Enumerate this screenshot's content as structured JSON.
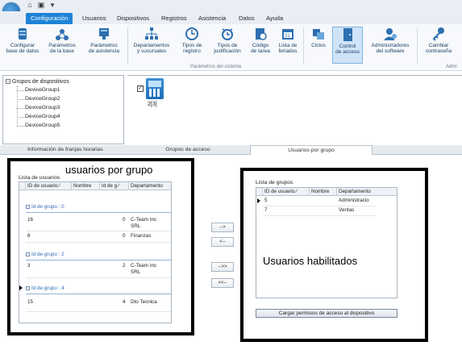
{
  "menu": {
    "tabs": [
      "Configuración",
      "Usuarios",
      "Dispositivos",
      "Registros",
      "Asistencia",
      "Datos",
      "Ayuda"
    ]
  },
  "ribbon": {
    "buttons": [
      {
        "line1": "Configurar",
        "line2": "base de datos",
        "icon": "database-icon"
      },
      {
        "line1": "Parámetros",
        "line2": "de la base",
        "icon": "base-params-icon"
      },
      {
        "line1": "Parámetros",
        "line2": "de asistencia",
        "icon": "attendance-params-icon"
      },
      {
        "line1": "Departamentos",
        "line2": "y sucursales",
        "icon": "org-chart-icon"
      },
      {
        "line1": "Tipos de",
        "line2": "registro",
        "icon": "clock-icon"
      },
      {
        "line1": "Tipos de",
        "line2": "justificación",
        "icon": "alarm-icon"
      },
      {
        "line1": "Código",
        "line2": "de tarea",
        "icon": "task-code-icon"
      },
      {
        "line1": "Lista de",
        "line2": "feriados",
        "icon": "calendar-icon"
      },
      {
        "line1": "Ciclos",
        "line2": "",
        "icon": "cycles-icon"
      },
      {
        "line1": "Control",
        "line2": "de acceso",
        "icon": "door-icon"
      },
      {
        "line1": "Administradores",
        "line2": "del software",
        "icon": "admin-user-icon"
      },
      {
        "line1": "Cambiar",
        "line2": "contraseña",
        "icon": "key-icon"
      }
    ],
    "group_label": "Parámetros del sistema",
    "group_label_right": "Admi"
  },
  "tree": {
    "root": "Grupos de dispositivos",
    "nodes": [
      "DeviceGroup1",
      "DeviceGroup2",
      "DeviceGroup3",
      "DeviceGroup4",
      "DeviceGroup5"
    ]
  },
  "device": {
    "label": "2[3]",
    "checked": true
  },
  "tabs": {
    "t1": "Información de franjas horarias",
    "t2": "Grupos de acceso",
    "t3": "Usuarios por grupo"
  },
  "left_panel": {
    "caption": "usuarios por grupo",
    "list_title": "Lista de usuarios",
    "columns": [
      "ID de usuario",
      "Nombre",
      "Id de g",
      "Departamento"
    ],
    "groups": [
      {
        "label": "Id de grupo : 0",
        "rows": [
          {
            "id": "16",
            "nombre": "",
            "grupo": "0",
            "depto": "C-Team Inc",
            "depto2": "SRL"
          },
          {
            "id": "6",
            "nombre": "",
            "grupo": "0",
            "depto": "Finanzas",
            "depto2": ""
          }
        ]
      },
      {
        "label": "Id de grupo : 2",
        "rows": [
          {
            "id": "3",
            "nombre": "",
            "grupo": "2",
            "depto": "C-Team Inc",
            "depto2": "SRL"
          }
        ]
      },
      {
        "label": "Id de grupo : 4",
        "rows": [
          {
            "id": "15",
            "nombre": "",
            "grupo": "4",
            "depto": "Dto Tecnica",
            "depto2": ""
          }
        ]
      }
    ]
  },
  "move_buttons": [
    "-->",
    "<--",
    "-->>",
    "<<--"
  ],
  "right_panel": {
    "caption": "Usuarios habilitados",
    "list_title": "Lista de grupos",
    "columns": [
      "ID de usuario",
      "Nombre",
      "Departamento"
    ],
    "rows": [
      {
        "id": "5",
        "nombre": "",
        "depto": "Administracio"
      },
      {
        "id": "7",
        "nombre": "",
        "depto": "Ventas"
      }
    ],
    "load_button": "Cargar permisos de acceso al dispositivo"
  }
}
